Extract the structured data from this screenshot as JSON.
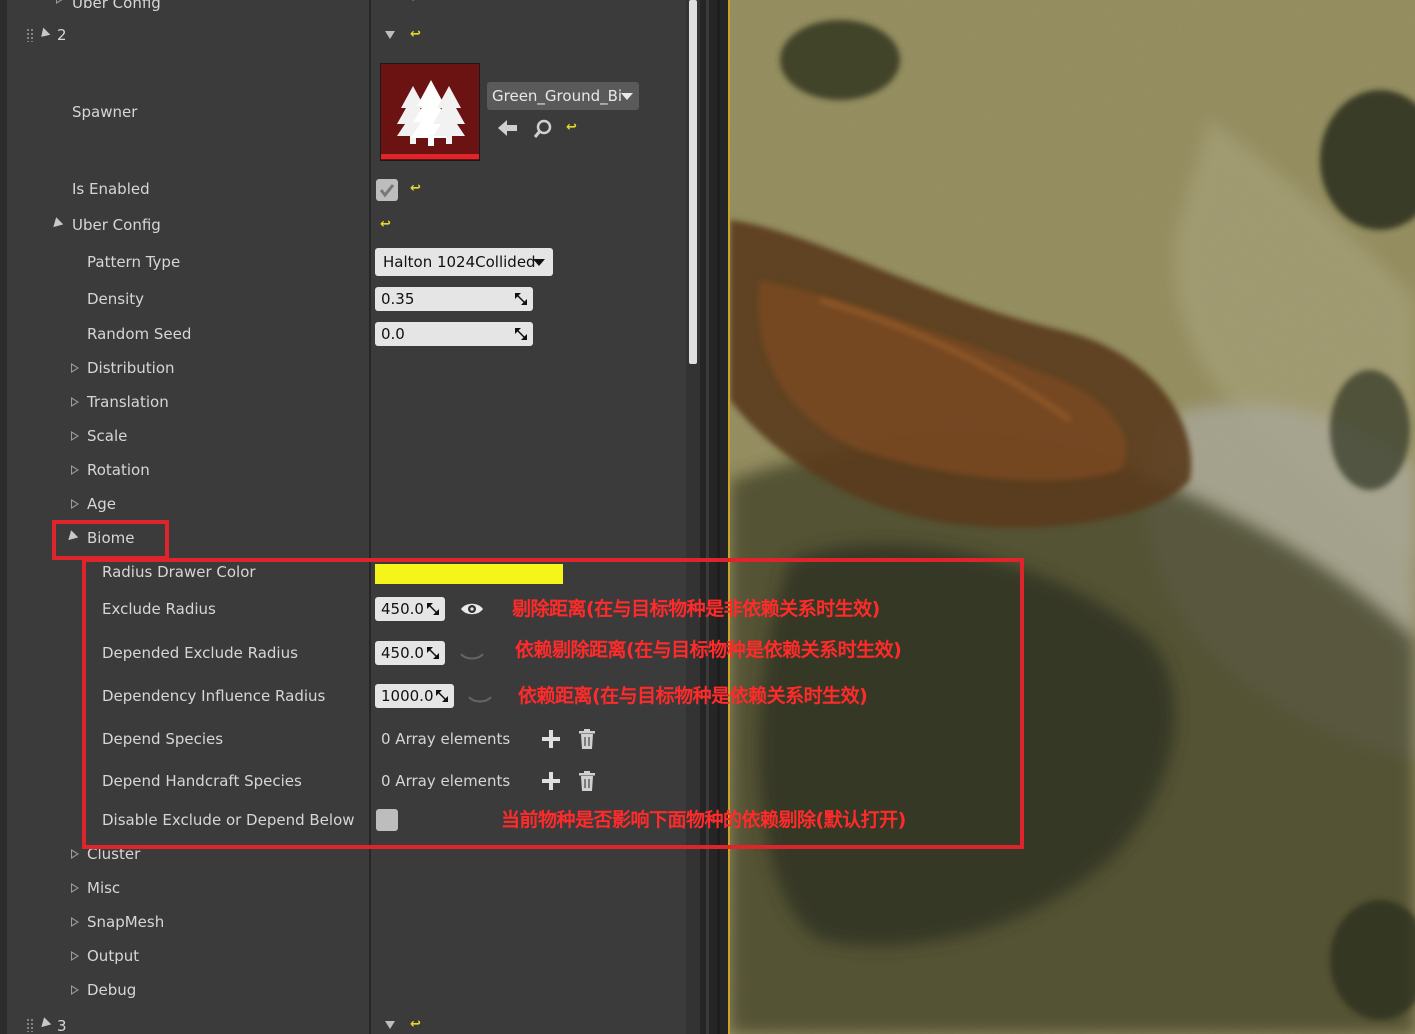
{
  "rows": {
    "prev_header": "Uber Config",
    "element_index": "2",
    "spawner": "Spawner",
    "spawner_asset": "Green_Ground_Bi",
    "is_enabled": "Is Enabled",
    "uber_config": "Uber Config",
    "pattern_type": "Pattern Type",
    "pattern_type_value": "Halton 1024Collided",
    "density": "Density",
    "density_value": "0.35",
    "random_seed": "Random Seed",
    "random_seed_value": "0.0",
    "distribution": "Distribution",
    "translation": "Translation",
    "scale": "Scale",
    "rotation": "Rotation",
    "age": "Age",
    "biome": "Biome",
    "radius_drawer_color": "Radius Drawer Color",
    "radius_drawer_color_hex": "#f5f51a",
    "exclude_radius": "Exclude Radius",
    "exclude_radius_value": "450.0",
    "depended_exclude_radius": "Depended Exclude Radius",
    "depended_exclude_radius_value": "450.0",
    "dependency_influence_radius": "Dependency Influence Radius",
    "dependency_influence_radius_value": "1000.0",
    "depend_species": "Depend Species",
    "depend_species_value": "0 Array elements",
    "depend_handcraft_species": "Depend Handcraft Species",
    "depend_handcraft_species_value": "0 Array elements",
    "disable_exclude": "Disable Exclude or Depend Below",
    "cluster": "Cluster",
    "misc": "Misc",
    "snapmesh": "SnapMesh",
    "output": "Output",
    "debug": "Debug",
    "next_index": "3"
  },
  "annotations": {
    "exclude_radius_note": "剔除距离(在与目标物种是非依赖关系时生效)",
    "depended_exclude_note": "依赖剔除距离(在与目标物种是依赖关系时生效)",
    "dependency_influence_note": "依赖距离(在与目标物种是依赖关系时生效)",
    "disable_note": "当前物种是否影响下面物种的依赖剔除(默认打开)"
  },
  "icons": {
    "reset": "reset-arrow-icon",
    "thumbnail": "trees-icon",
    "browse_back": "arrow-left-icon",
    "find": "search-icon",
    "visibility": "eye-icon",
    "add": "plus-icon",
    "delete": "trash-icon"
  },
  "colors": {
    "annotation": "#e0242b",
    "reset_arrow": "#e6d72a",
    "thumbnail_bg": "#6b1212"
  }
}
